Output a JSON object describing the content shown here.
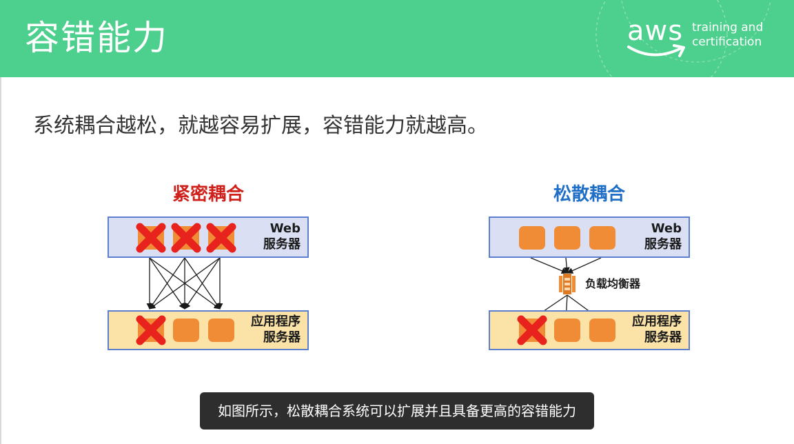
{
  "header": {
    "title": "容错能力",
    "logo_mark": "aws",
    "logo_text_line1": "training and",
    "logo_text_line2": "certification"
  },
  "subtitle": "系统耦合越松，就越容易扩展，容错能力就越高。",
  "diagrams": [
    {
      "id": "tight",
      "title": "紧密耦合",
      "title_color": "#d0201c",
      "web_tier": {
        "label_line1": "Web",
        "label_line2": "服务器",
        "servers": [
          {
            "failed": true
          },
          {
            "failed": true
          },
          {
            "failed": true
          }
        ]
      },
      "app_tier": {
        "label_line1": "应用程序",
        "label_line2": "服务器",
        "servers": [
          {
            "failed": true
          },
          {
            "failed": false
          },
          {
            "failed": false
          }
        ]
      },
      "wiring": "every web server connects directly to every app server"
    },
    {
      "id": "loose",
      "title": "松散耦合",
      "title_color": "#1f6fc7",
      "web_tier": {
        "label_line1": "Web",
        "label_line2": "服务器",
        "servers": [
          {
            "failed": false
          },
          {
            "failed": false
          },
          {
            "failed": false
          }
        ]
      },
      "load_balancer": {
        "label": "负载均衡器",
        "icon": "load-balancer-icon"
      },
      "app_tier": {
        "label_line1": "应用程序",
        "label_line2": "服务器",
        "servers": [
          {
            "failed": true
          },
          {
            "failed": false
          },
          {
            "failed": false
          }
        ]
      },
      "wiring": "web servers connect to a load balancer that distributes to app servers"
    }
  ],
  "caption": "如图所示，松散耦合系统可以扩展并且具备更高的容错能力",
  "colors": {
    "header": "#4dcf8d",
    "server": "#f08c36",
    "failed_mark": "#e8221c",
    "web_tier_fill": "#dadff3",
    "app_tier_fill": "#fbe3a8",
    "tier_border": "#5b7fcc",
    "caption_bg": "#2e2e2e"
  }
}
